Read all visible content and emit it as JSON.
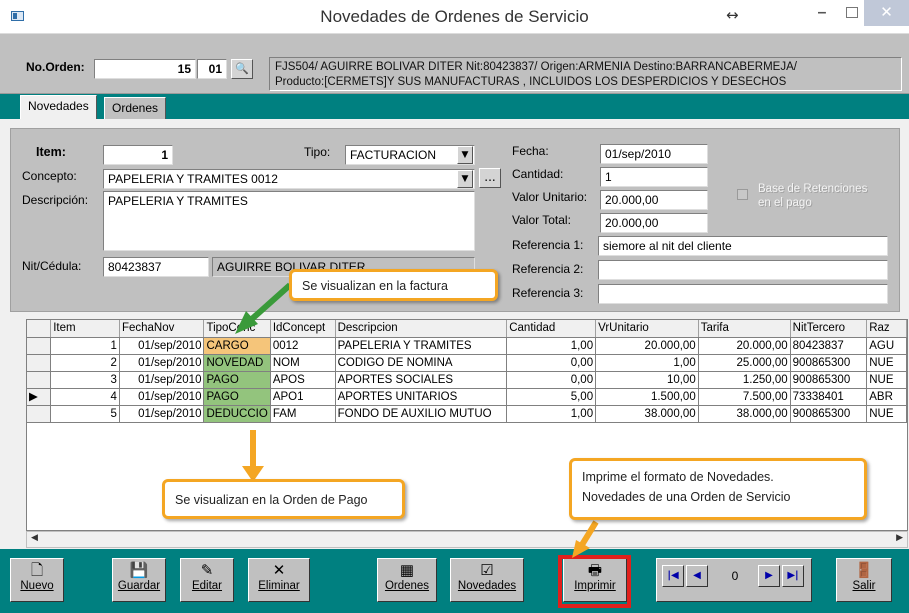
{
  "window": {
    "title": "Novedades de Ordenes de Servicio"
  },
  "header": {
    "order_label": "No.Orden:",
    "order_number": "15",
    "order_suffix": "01",
    "info_line1": "FJS504/ AGUIRRE BOLIVAR DITER Nit:80423837/ Origen:ARMENIA Destino:BARRANCABERMEJA/",
    "info_line2": "Producto:[CERMETS]Y SUS MANUFACTURAS , INCLUIDOS LOS DESPERDICIOS Y DESECHOS"
  },
  "tabs": [
    {
      "label": "Novedades"
    },
    {
      "label": "Ordenes"
    }
  ],
  "form": {
    "item_label": "Item:",
    "item_value": "1",
    "tipo_label": "Tipo:",
    "tipo_value": "FACTURACION",
    "concepto_label": "Concepto:",
    "concepto_value": "PAPELERIA Y TRAMITES 0012",
    "descripcion_label": "Descripción:",
    "descripcion_value": "PAPELERIA Y TRAMITES",
    "nit_label": "Nit/Cédula:",
    "nit_value": "80423837",
    "nit_name": "AGUIRRE BOLIVAR DITER",
    "dots_label": "...",
    "fecha_label": "Fecha:",
    "fecha_value": "01/sep/2010",
    "cantidad_label": "Cantidad:",
    "cantidad_value": "1",
    "valor_unitario_label": "Valor Unitario:",
    "valor_unitario_value": "20.000,00",
    "valor_total_label": "Valor Total:",
    "valor_total_value": "20.000,00",
    "ref1_label": "Referencia 1:",
    "ref1_value": "siemore al nit del cliente",
    "ref2_label": "Referencia 2:",
    "ref2_value": "",
    "ref3_label": "Referencia 3:",
    "ref3_value": "",
    "base_retenciones_line1": "Base de Retenciones",
    "base_retenciones_line2": "en el pago"
  },
  "grid": {
    "headers": [
      "Item",
      "FechaNov",
      "TipoConc",
      "IdConcept",
      "Descripcion",
      "Cantidad",
      "VrUnitario",
      "Tarifa",
      "NitTercero",
      "Raz"
    ],
    "rows": [
      [
        "1",
        "01/sep/2010",
        "CARGO",
        "0012",
        "PAPELERIA Y TRAMITES",
        "1,00",
        "20.000,00",
        "20.000,00",
        "80423837",
        "AGU"
      ],
      [
        "2",
        "01/sep/2010",
        "NOVEDAD",
        "NOM",
        "CODIGO DE NOMINA",
        "0,00",
        "1,00",
        "25.000,00",
        "900865300",
        "NUE"
      ],
      [
        "3",
        "01/sep/2010",
        "PAGO",
        "APOS",
        "APORTES SOCIALES",
        "0,00",
        "10,00",
        "1.250,00",
        "900865300",
        "NUE"
      ],
      [
        "4",
        "01/sep/2010",
        "PAGO",
        "APO1",
        "APORTES UNITARIOS",
        "5,00",
        "1.500,00",
        "7.500,00",
        "73338401",
        "ABR"
      ],
      [
        "5",
        "01/sep/2010",
        "DEDUCCIO",
        "FAM",
        "FONDO DE AUXILIO MUTUO",
        "1,00",
        "38.000,00",
        "38.000,00",
        "900865300",
        "NUE"
      ]
    ],
    "current_row_marker": "▶"
  },
  "toolbar": {
    "nuevo": "Nuevo",
    "guardar": "Guardar",
    "editar": "Editar",
    "eliminar": "Eliminar",
    "ordenes": "Ordenes",
    "novedades": "Novedades",
    "imprimir": "Imprimir",
    "salir": "Salir",
    "record_position": "0"
  },
  "callouts": {
    "factura": "Se visualizan en la factura",
    "orden_pago": "Se visualizan en la Orden de Pago",
    "imprime_line1": "Imprime el formato de Novedades.",
    "imprime_line2": "Novedades de una Orden de Servicio"
  },
  "colors": {
    "teal": "#008080",
    "cargo_highlight": "#f5c57a",
    "pago_highlight": "#93c47d",
    "callout_border": "#f4a623",
    "arrow_green": "#3a9a3a",
    "arrow_orange": "#f4a623",
    "highlight_red": "#e0201c"
  }
}
